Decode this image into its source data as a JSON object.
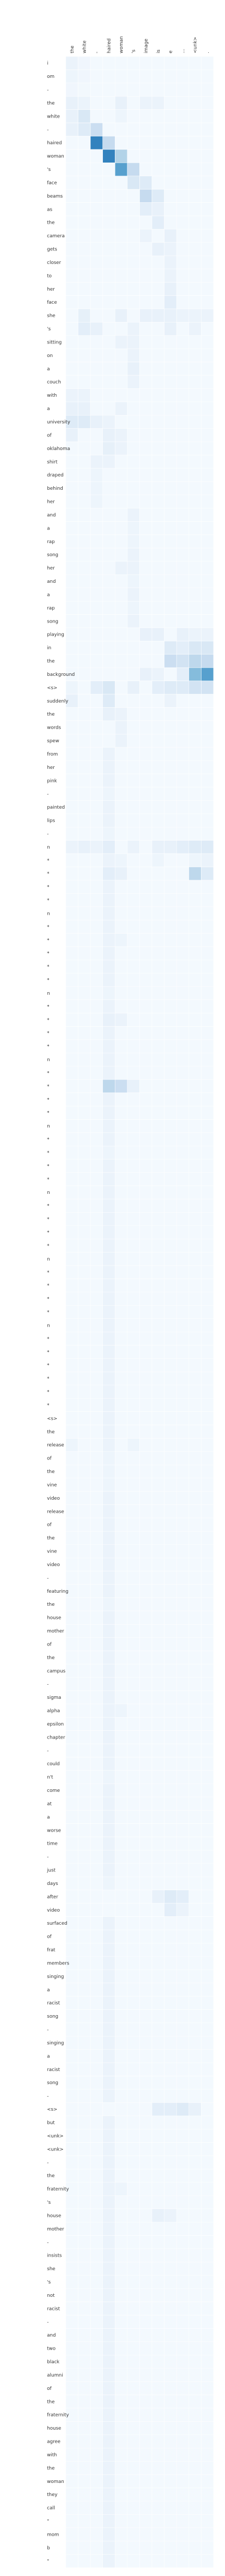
{
  "chart_data": {
    "type": "heatmap",
    "x_tokens": [
      "the",
      "white",
      "-",
      "haired",
      "woman",
      "'s",
      "image",
      "is",
      "e",
      "...",
      "<unk>",
      "."
    ],
    "y_tokens": [
      "i",
      "om",
      "-",
      "the",
      "white",
      "-",
      "haired",
      "woman",
      "'s",
      "face",
      "beams",
      "as",
      "the",
      "camera",
      "gets",
      "closer",
      "to",
      "her",
      "face",
      "she",
      "'s",
      "sitting",
      "on",
      "a",
      "couch",
      "with",
      "a",
      "university",
      "of",
      "oklahoma",
      "shirt",
      "draped",
      "behind",
      "her",
      "and",
      "a",
      "rap",
      "song",
      "her",
      "and",
      "a",
      "rap",
      "song",
      "playing",
      "in",
      "the",
      "background",
      "<s>",
      "suddenly",
      "the",
      "words",
      "spew",
      "from",
      "her",
      "pink",
      "-",
      "painted",
      "lips",
      "-",
      "n",
      "*",
      "*",
      "*",
      "*",
      "n",
      "*",
      "*",
      "*",
      "*",
      "*",
      "n",
      "*",
      "*",
      "*",
      "*",
      "n",
      "*",
      "*",
      "*",
      "*",
      "n",
      "*",
      "*",
      "*",
      "*",
      "n",
      "*",
      "*",
      "*",
      "*",
      "n",
      "*",
      "*",
      "*",
      "*",
      "n",
      "*",
      "*",
      "*",
      "*",
      "*",
      "*",
      "<s>",
      "the",
      "release",
      "of",
      "the",
      "vine",
      "video",
      "release",
      "of",
      "the",
      "vine",
      "video",
      "-",
      "featuring",
      "the",
      "house",
      "mother",
      "of",
      "the",
      "campus",
      "-",
      "sigma",
      "alpha",
      "epsilon",
      "chapter",
      "-",
      "could",
      "n't",
      "come",
      "at",
      "a",
      "worse",
      "time",
      "-",
      "just",
      "days",
      "after",
      "video",
      "surfaced",
      "of",
      "frat",
      "members",
      "singing",
      "a",
      "racist",
      "song",
      "-",
      "singing",
      "a",
      "racist",
      "song",
      "-",
      "<s>",
      "but",
      "<unk>",
      "<unk>",
      "-",
      "the",
      "fraternity",
      "'s",
      "house",
      "mother",
      "-",
      "insists",
      "she",
      "'s",
      "not",
      "racist",
      "-",
      "and",
      "two",
      "black",
      "alumni",
      "of",
      "the",
      "fraternity",
      "house",
      "agree",
      "with",
      "the",
      "woman",
      "they",
      "call",
      "\"",
      "mom",
      "b",
      "\""
    ],
    "weights_sparse": [
      [
        0,
        0,
        0.05
      ],
      [
        0,
        1,
        0.03
      ],
      [
        1,
        0,
        0.04
      ],
      [
        1,
        1,
        0.03
      ],
      [
        2,
        0,
        0.03
      ],
      [
        2,
        1,
        0.02
      ],
      [
        3,
        0,
        0.06
      ],
      [
        3,
        1,
        0.05
      ],
      [
        3,
        4,
        0.06
      ],
      [
        3,
        6,
        0.05
      ],
      [
        3,
        7,
        0.05
      ],
      [
        4,
        1,
        0.12
      ],
      [
        4,
        0,
        0.06
      ],
      [
        4,
        4,
        0.04
      ],
      [
        5,
        2,
        0.18
      ],
      [
        5,
        1,
        0.1
      ],
      [
        5,
        0,
        0.06
      ],
      [
        6,
        2,
        0.55
      ],
      [
        6,
        3,
        0.2
      ],
      [
        7,
        3,
        0.55
      ],
      [
        7,
        4,
        0.25
      ],
      [
        8,
        4,
        0.45
      ],
      [
        8,
        5,
        0.2
      ],
      [
        9,
        5,
        0.12
      ],
      [
        9,
        6,
        0.1
      ],
      [
        10,
        6,
        0.2
      ],
      [
        10,
        7,
        0.1
      ],
      [
        11,
        6,
        0.08
      ],
      [
        11,
        7,
        0.06
      ],
      [
        12,
        7,
        0.08
      ],
      [
        13,
        8,
        0.06
      ],
      [
        13,
        6,
        0.05
      ],
      [
        14,
        7,
        0.06
      ],
      [
        14,
        8,
        0.05
      ],
      [
        15,
        8,
        0.05
      ],
      [
        16,
        8,
        0.05
      ],
      [
        17,
        8,
        0.06
      ],
      [
        18,
        8,
        0.08
      ],
      [
        19,
        1,
        0.07
      ],
      [
        19,
        4,
        0.06
      ],
      [
        19,
        6,
        0.06
      ],
      [
        19,
        7,
        0.06
      ],
      [
        19,
        8,
        0.06
      ],
      [
        19,
        9,
        0.05
      ],
      [
        19,
        10,
        0.05
      ],
      [
        19,
        11,
        0.05
      ],
      [
        20,
        1,
        0.08
      ],
      [
        20,
        2,
        0.06
      ],
      [
        20,
        5,
        0.05
      ],
      [
        20,
        8,
        0.06
      ],
      [
        20,
        10,
        0.05
      ],
      [
        21,
        4,
        0.05
      ],
      [
        21,
        5,
        0.05
      ],
      [
        22,
        5,
        0.05
      ],
      [
        23,
        5,
        0.06
      ],
      [
        24,
        5,
        0.05
      ],
      [
        25,
        0,
        0.05
      ],
      [
        25,
        1,
        0.05
      ],
      [
        26,
        0,
        0.06
      ],
      [
        26,
        1,
        0.06
      ],
      [
        26,
        4,
        0.05
      ],
      [
        27,
        0,
        0.1
      ],
      [
        27,
        1,
        0.1
      ],
      [
        27,
        2,
        0.06
      ],
      [
        27,
        3,
        0.05
      ],
      [
        28,
        0,
        0.06
      ],
      [
        28,
        3,
        0.06
      ],
      [
        28,
        4,
        0.05
      ],
      [
        29,
        3,
        0.07
      ],
      [
        29,
        4,
        0.05
      ],
      [
        30,
        2,
        0.05
      ],
      [
        30,
        3,
        0.05
      ],
      [
        31,
        2,
        0.04
      ],
      [
        32,
        2,
        0.04
      ],
      [
        33,
        2,
        0.04
      ],
      [
        34,
        5,
        0.05
      ],
      [
        35,
        5,
        0.04
      ],
      [
        36,
        5,
        0.04
      ],
      [
        37,
        5,
        0.05
      ],
      [
        38,
        4,
        0.05
      ],
      [
        38,
        5,
        0.05
      ],
      [
        39,
        5,
        0.04
      ],
      [
        40,
        5,
        0.05
      ],
      [
        41,
        5,
        0.04
      ],
      [
        42,
        5,
        0.05
      ],
      [
        43,
        6,
        0.06
      ],
      [
        43,
        7,
        0.06
      ],
      [
        43,
        9,
        0.06
      ],
      [
        43,
        10,
        0.05
      ],
      [
        43,
        11,
        0.05
      ],
      [
        44,
        8,
        0.1
      ],
      [
        44,
        9,
        0.08
      ],
      [
        44,
        10,
        0.12
      ],
      [
        44,
        11,
        0.12
      ],
      [
        45,
        8,
        0.18
      ],
      [
        45,
        9,
        0.15
      ],
      [
        45,
        10,
        0.22
      ],
      [
        45,
        11,
        0.2
      ],
      [
        46,
        6,
        0.06
      ],
      [
        46,
        7,
        0.05
      ],
      [
        46,
        9,
        0.08
      ],
      [
        46,
        10,
        0.35
      ],
      [
        46,
        11,
        0.45
      ],
      [
        47,
        0,
        0.04
      ],
      [
        47,
        2,
        0.08
      ],
      [
        47,
        3,
        0.12
      ],
      [
        47,
        5,
        0.06
      ],
      [
        47,
        7,
        0.08
      ],
      [
        47,
        8,
        0.1
      ],
      [
        47,
        9,
        0.1
      ],
      [
        47,
        10,
        0.15
      ],
      [
        47,
        11,
        0.15
      ],
      [
        48,
        0,
        0.06
      ],
      [
        48,
        3,
        0.1
      ],
      [
        48,
        8,
        0.05
      ],
      [
        49,
        3,
        0.06
      ],
      [
        49,
        4,
        0.05
      ],
      [
        50,
        4,
        0.05
      ],
      [
        51,
        4,
        0.05
      ],
      [
        52,
        3,
        0.05
      ],
      [
        53,
        3,
        0.05
      ],
      [
        54,
        3,
        0.05
      ],
      [
        55,
        3,
        0.04
      ],
      [
        56,
        3,
        0.05
      ],
      [
        57,
        3,
        0.05
      ],
      [
        58,
        3,
        0.04
      ],
      [
        59,
        0,
        0.05
      ],
      [
        59,
        1,
        0.06
      ],
      [
        59,
        2,
        0.05
      ],
      [
        59,
        3,
        0.08
      ],
      [
        59,
        5,
        0.05
      ],
      [
        59,
        7,
        0.06
      ],
      [
        59,
        8,
        0.06
      ],
      [
        59,
        9,
        0.08
      ],
      [
        59,
        10,
        0.1
      ],
      [
        59,
        11,
        0.1
      ],
      [
        60,
        3,
        0.05
      ],
      [
        60,
        4,
        0.04
      ],
      [
        60,
        7,
        0.04
      ],
      [
        60,
        10,
        0.04
      ],
      [
        60,
        11,
        0.05
      ],
      [
        61,
        3,
        0.08
      ],
      [
        61,
        4,
        0.06
      ],
      [
        61,
        10,
        0.22
      ],
      [
        61,
        11,
        0.1
      ],
      [
        62,
        3,
        0.05
      ],
      [
        63,
        3,
        0.05
      ],
      [
        64,
        3,
        0.05
      ],
      [
        65,
        3,
        0.05
      ],
      [
        66,
        3,
        0.05
      ],
      [
        66,
        4,
        0.04
      ],
      [
        67,
        3,
        0.05
      ],
      [
        68,
        3,
        0.05
      ],
      [
        69,
        3,
        0.05
      ],
      [
        70,
        3,
        0.04
      ],
      [
        71,
        3,
        0.05
      ],
      [
        72,
        3,
        0.06
      ],
      [
        72,
        4,
        0.05
      ],
      [
        73,
        3,
        0.05
      ],
      [
        74,
        3,
        0.05
      ],
      [
        75,
        3,
        0.05
      ],
      [
        76,
        3,
        0.05
      ],
      [
        77,
        3,
        0.22
      ],
      [
        77,
        4,
        0.18
      ],
      [
        77,
        5,
        0.06
      ],
      [
        78,
        3,
        0.05
      ],
      [
        79,
        3,
        0.05
      ],
      [
        80,
        3,
        0.05
      ],
      [
        81,
        3,
        0.05
      ],
      [
        82,
        3,
        0.04
      ],
      [
        83,
        3,
        0.05
      ],
      [
        84,
        3,
        0.05
      ],
      [
        85,
        3,
        0.05
      ],
      [
        86,
        3,
        0.05
      ],
      [
        87,
        3,
        0.05
      ],
      [
        88,
        3,
        0.05
      ],
      [
        89,
        3,
        0.05
      ],
      [
        90,
        3,
        0.05
      ],
      [
        91,
        3,
        0.05
      ],
      [
        92,
        3,
        0.05
      ],
      [
        93,
        3,
        0.05
      ],
      [
        94,
        3,
        0.05
      ],
      [
        95,
        3,
        0.05
      ],
      [
        96,
        3,
        0.05
      ],
      [
        97,
        3,
        0.05
      ],
      [
        98,
        3,
        0.05
      ],
      [
        99,
        3,
        0.05
      ],
      [
        100,
        3,
        0.05
      ],
      [
        101,
        3,
        0.05
      ],
      [
        102,
        3,
        0.05
      ],
      [
        103,
        3,
        0.05
      ],
      [
        104,
        0,
        0.04
      ],
      [
        104,
        3,
        0.05
      ],
      [
        104,
        5,
        0.04
      ],
      [
        105,
        3,
        0.04
      ],
      [
        106,
        3,
        0.04
      ],
      [
        107,
        3,
        0.04
      ],
      [
        108,
        3,
        0.05
      ],
      [
        109,
        3,
        0.05
      ],
      [
        110,
        3,
        0.05
      ],
      [
        111,
        3,
        0.05
      ],
      [
        112,
        3,
        0.05
      ],
      [
        113,
        3,
        0.05
      ],
      [
        114,
        3,
        0.05
      ],
      [
        115,
        3,
        0.05
      ],
      [
        116,
        3,
        0.04
      ],
      [
        117,
        3,
        0.05
      ],
      [
        118,
        3,
        0.05
      ],
      [
        119,
        3,
        0.05
      ],
      [
        120,
        3,
        0.05
      ],
      [
        121,
        3,
        0.05
      ],
      [
        122,
        3,
        0.05
      ],
      [
        123,
        3,
        0.05
      ],
      [
        124,
        3,
        0.05
      ],
      [
        124,
        4,
        0.04
      ],
      [
        125,
        3,
        0.05
      ],
      [
        126,
        3,
        0.05
      ],
      [
        127,
        3,
        0.05
      ],
      [
        128,
        3,
        0.05
      ],
      [
        129,
        3,
        0.04
      ],
      [
        130,
        3,
        0.05
      ],
      [
        131,
        3,
        0.05
      ],
      [
        132,
        3,
        0.05
      ],
      [
        133,
        3,
        0.05
      ],
      [
        134,
        3,
        0.05
      ],
      [
        135,
        3,
        0.05
      ],
      [
        136,
        3,
        0.05
      ],
      [
        137,
        3,
        0.04
      ],
      [
        138,
        7,
        0.06
      ],
      [
        138,
        8,
        0.1
      ],
      [
        138,
        9,
        0.08
      ],
      [
        139,
        8,
        0.08
      ],
      [
        139,
        9,
        0.05
      ],
      [
        140,
        3,
        0.05
      ],
      [
        141,
        3,
        0.05
      ],
      [
        142,
        3,
        0.05
      ],
      [
        143,
        3,
        0.05
      ],
      [
        144,
        3,
        0.05
      ],
      [
        145,
        3,
        0.05
      ],
      [
        146,
        3,
        0.05
      ],
      [
        147,
        3,
        0.05
      ],
      [
        148,
        3,
        0.05
      ],
      [
        149,
        3,
        0.05
      ],
      [
        150,
        3,
        0.05
      ],
      [
        151,
        3,
        0.05
      ],
      [
        152,
        3,
        0.05
      ],
      [
        153,
        3,
        0.05
      ],
      [
        154,
        7,
        0.08
      ],
      [
        154,
        8,
        0.08
      ],
      [
        154,
        9,
        0.1
      ],
      [
        154,
        10,
        0.06
      ],
      [
        155,
        3,
        0.05
      ],
      [
        156,
        3,
        0.05
      ],
      [
        157,
        3,
        0.05
      ],
      [
        158,
        3,
        0.05
      ],
      [
        159,
        3,
        0.05
      ],
      [
        160,
        3,
        0.05
      ],
      [
        160,
        4,
        0.04
      ],
      [
        161,
        3,
        0.05
      ],
      [
        162,
        3,
        0.05
      ],
      [
        162,
        7,
        0.06
      ],
      [
        162,
        8,
        0.05
      ],
      [
        163,
        3,
        0.05
      ],
      [
        164,
        3,
        0.05
      ],
      [
        165,
        3,
        0.05
      ],
      [
        166,
        3,
        0.05
      ],
      [
        167,
        3,
        0.05
      ],
      [
        168,
        3,
        0.05
      ],
      [
        169,
        3,
        0.05
      ],
      [
        170,
        3,
        0.05
      ],
      [
        171,
        3,
        0.05
      ],
      [
        172,
        3,
        0.05
      ],
      [
        173,
        3,
        0.05
      ],
      [
        174,
        3,
        0.05
      ],
      [
        175,
        3,
        0.05
      ],
      [
        176,
        3,
        0.05
      ],
      [
        177,
        3,
        0.05
      ],
      [
        178,
        3,
        0.05
      ],
      [
        179,
        3,
        0.05
      ],
      [
        180,
        3,
        0.05
      ],
      [
        181,
        3,
        0.05
      ],
      [
        182,
        3,
        0.05
      ],
      [
        183,
        3,
        0.05
      ],
      [
        184,
        3,
        0.05
      ],
      [
        185,
        3,
        0.05
      ],
      [
        186,
        3,
        0.05
      ],
      [
        187,
        3,
        0.05
      ],
      [
        188,
        3,
        0.05
      ],
      [
        189,
        3,
        0.05
      ],
      [
        190,
        3,
        0.05
      ],
      [
        191,
        3,
        0.05
      ],
      [
        192,
        3,
        0.05
      ],
      [
        193,
        3,
        0.05
      ],
      [
        194,
        3,
        0.05
      ],
      [
        195,
        3,
        0.05
      ],
      [
        196,
        3,
        0.05
      ],
      [
        197,
        3,
        0.05
      ]
    ],
    "base_weight": 0.015,
    "colormap": [
      "#f7fbff",
      "#deebf7",
      "#c6dbef",
      "#9ecae1",
      "#6baed6",
      "#4292c6",
      "#2171b5"
    ],
    "grid_color": "#ffffff",
    "title": "",
    "xlabel": "",
    "ylabel": ""
  }
}
